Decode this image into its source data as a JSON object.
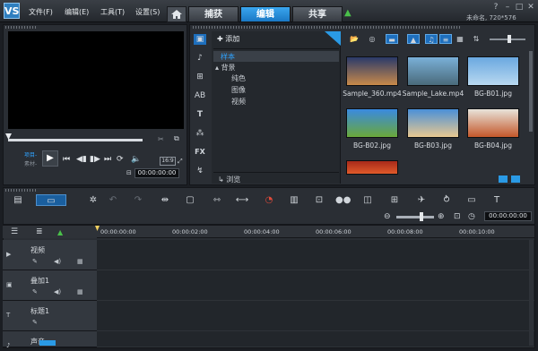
{
  "app": {
    "logo": "VS",
    "menus": [
      "文件(F)",
      "编辑(E)",
      "工具(T)",
      "设置(S)"
    ],
    "project_info": "未命名, 720*576"
  },
  "tabs": [
    {
      "label": "捕获",
      "active": false
    },
    {
      "label": "编辑",
      "active": true
    },
    {
      "label": "共享",
      "active": false
    }
  ],
  "player": {
    "project_label": "项目-",
    "clip_label": "素材-",
    "ratio": "16:9",
    "timecode": "00:00:00:00"
  },
  "library": {
    "add_label": "添加",
    "tree": {
      "sample": "样本",
      "background": "背景",
      "children": [
        "纯色",
        "图像",
        "视频"
      ]
    },
    "browse_label": "浏览",
    "thumbnails": [
      {
        "label": "Sample_360.mp4",
        "colors": [
          "#2a3a6a",
          "#c88a4a"
        ]
      },
      {
        "label": "Sample_Lake.mp4",
        "colors": [
          "#7ab0d8",
          "#4a6a7a"
        ]
      },
      {
        "label": "BG-B01.jpg",
        "colors": [
          "#6aa8e0",
          "#b8d8f0"
        ]
      },
      {
        "label": "BG-B02.jpg",
        "colors": [
          "#3a8ae0",
          "#6aa83a"
        ]
      },
      {
        "label": "BG-B03.jpg",
        "colors": [
          "#4a90d8",
          "#e8c890"
        ]
      },
      {
        "label": "BG-B04.jpg",
        "colors": [
          "#e8e4da",
          "#c4572a"
        ]
      },
      {
        "label": "",
        "colors": [
          "#a82a1a",
          "#e05a2a"
        ]
      }
    ]
  },
  "toolbar": {
    "timecode": "00:00:00:00"
  },
  "timeline": {
    "ticks": [
      "00:00:00:00",
      "00:00:02:00",
      "00:00:04:00",
      "00:00:06:00",
      "00:00:08:00",
      "00:00:10:00"
    ],
    "tracks": [
      "视频",
      "叠加1",
      "标题1",
      "声音"
    ]
  },
  "icons": [
    "home-icon",
    "upload-icon",
    "play-icon",
    "scissors-icon",
    "undo-icon",
    "redo-icon",
    "zoom-in-icon",
    "zoom-out-icon",
    "clock-icon"
  ]
}
